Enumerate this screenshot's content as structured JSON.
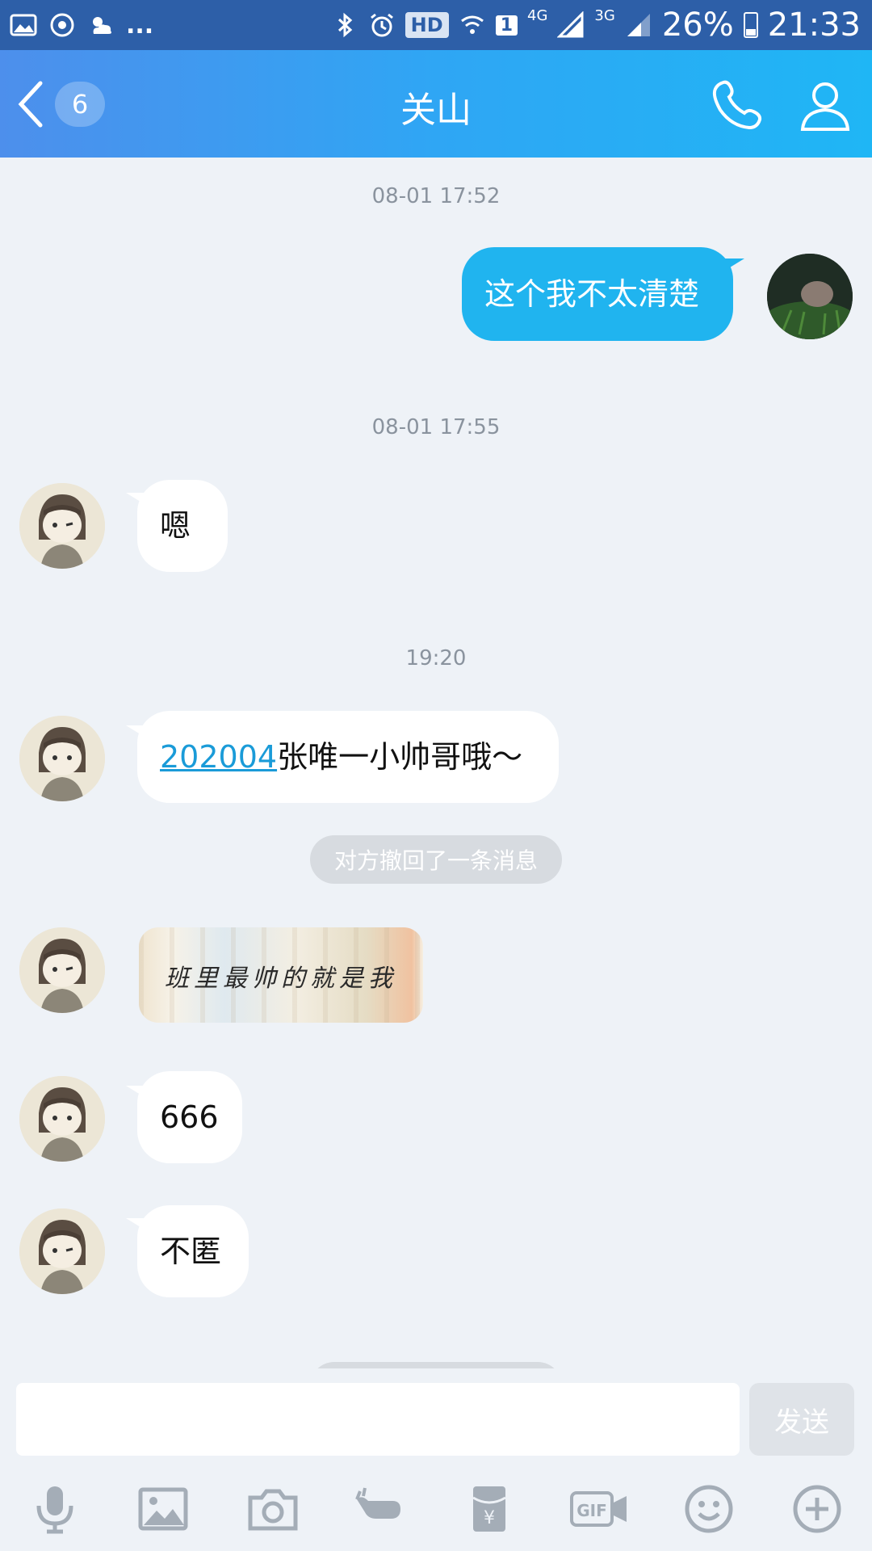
{
  "status_bar": {
    "hd_label": "HD",
    "sim_label": "1",
    "net1_label": "4G",
    "net2_label": "3G",
    "battery": "26%",
    "time": "21:33",
    "more": "..."
  },
  "header": {
    "unread_count": "6",
    "title": "关山"
  },
  "messages": {
    "ts1": "08-01 17:52",
    "out1": "这个我不太清楚",
    "ts2": "08-01 17:55",
    "in1": "嗯",
    "ts3": "19:20",
    "in2_link": "202004",
    "in2_rest": "张唯一小帅哥哦～",
    "recalled": "对方撤回了一条消息",
    "sticker_text": "班里最帅的就是我",
    "in4": "666",
    "in5": "不匿"
  },
  "input": {
    "send_label": "发送",
    "value": ""
  },
  "toolbar": {
    "icons": [
      "mic-icon",
      "image-icon",
      "camera-icon",
      "poke-icon",
      "red-packet-icon",
      "gif-icon",
      "emoji-icon",
      "plus-icon"
    ]
  },
  "colors": {
    "accent": "#20b4ef",
    "header_start": "#4d8fec",
    "header_end": "#1fb6f5",
    "background": "#eef2f7"
  }
}
